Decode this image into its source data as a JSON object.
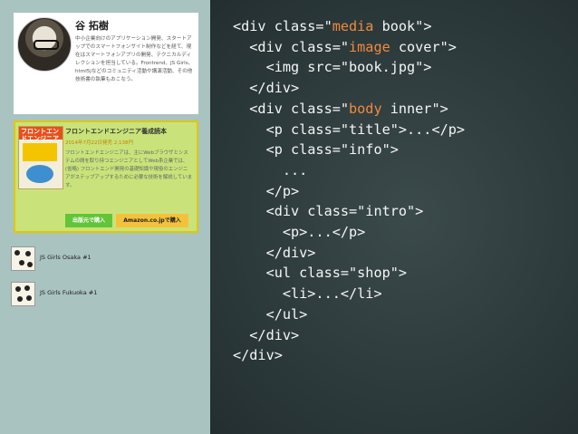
{
  "profile": {
    "name": "谷 拓樹",
    "bio": "中小企業向けのアプリケーション開発、スタートアップでのスマートフォンサイト制作などを経て、現在はスマートフォンアプリの開発、テクニカルディレクションを担当している。Frontrend、JS Girls、html5jなどのコミュニティ活動や講演活動、その他技術書の執筆もおこなう。"
  },
  "book": {
    "title": "フロントエンドエンジニア養成読本",
    "meta": "2014年7月22日発売 2,138円",
    "description": "フロントエンドエンジニアは、主にWebブラウザとシステムの間を取り持つエンジニアとしてWeb系企業では、(省略) フロントエンド開発の基礎知識や現役のエンジニアがステップアップするために必要な技術を解説しています。",
    "cover_text": "フロントエンドエンジニア",
    "publisher_button": "出版元で購入",
    "amazon_button": "Amazon.co.jpで購入"
  },
  "events": [
    {
      "label": "JS Girls Osaka #1"
    },
    {
      "label": "JS Girls Fukuoka #1"
    }
  ],
  "code_lines": [
    {
      "indent": "",
      "pre": "<div class=\"",
      "str": "media",
      "post": " book\">"
    },
    {
      "indent": "  ",
      "pre": "<div class=\"",
      "str": "image",
      "post": " cover\">"
    },
    {
      "indent": "    ",
      "pre": "<img src=\"book.jpg\">",
      "str": "",
      "post": ""
    },
    {
      "indent": "  ",
      "pre": "</div>",
      "str": "",
      "post": ""
    },
    {
      "indent": "  ",
      "pre": "<div class=\"",
      "str": "body",
      "post": " inner\">"
    },
    {
      "indent": "    ",
      "pre": "<p class=\"title\">...</p>",
      "str": "",
      "post": ""
    },
    {
      "indent": "    ",
      "pre": "<p class=\"info\">",
      "str": "",
      "post": ""
    },
    {
      "indent": "      ",
      "pre": "...",
      "str": "",
      "post": ""
    },
    {
      "indent": "    ",
      "pre": "</p>",
      "str": "",
      "post": ""
    },
    {
      "indent": "    ",
      "pre": "<div class=\"intro\">",
      "str": "",
      "post": ""
    },
    {
      "indent": "      ",
      "pre": "<p>...</p>",
      "str": "",
      "post": ""
    },
    {
      "indent": "    ",
      "pre": "</div>",
      "str": "",
      "post": ""
    },
    {
      "indent": "    ",
      "pre": "<ul class=\"shop\">",
      "str": "",
      "post": ""
    },
    {
      "indent": "      ",
      "pre": "<li>...</li>",
      "str": "",
      "post": ""
    },
    {
      "indent": "    ",
      "pre": "</ul>",
      "str": "",
      "post": ""
    },
    {
      "indent": "  ",
      "pre": "</div>",
      "str": "",
      "post": ""
    },
    {
      "indent": "",
      "pre": "</div>",
      "str": "",
      "post": ""
    }
  ],
  "colors": {
    "code_string": "#f08a3c",
    "left_panel_bg": "#a9c3c0",
    "book_card_bg": "#c9e37a"
  }
}
